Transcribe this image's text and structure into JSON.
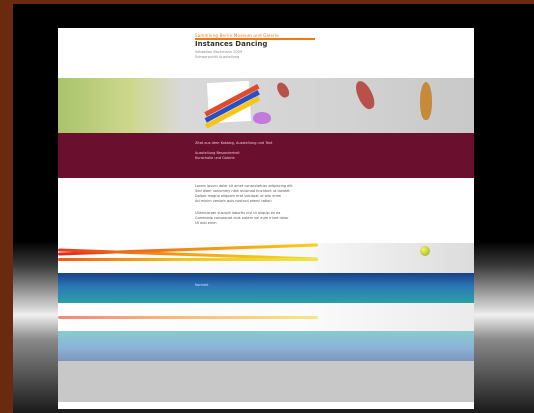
{
  "header": {
    "kicker": "Sammlung Berlin Museum und Galerie",
    "title": "Instances Dancing",
    "sub_lines": [
      "Sebastian Bachmann 2009",
      "Schwerpunkt Ausstellung"
    ]
  },
  "maroon": {
    "lines": [
      "Zitat aus dem Katalog, Ausstellung und Text",
      "Ausstellung Besonderheit",
      "Kunsthalle und Galerie"
    ]
  },
  "body": {
    "lines": [
      "Lorem ipsum dolor sit amet consectetuer adipiscing elit",
      "Sed diam nonummy nibh euismod tincidunt ut laoreet",
      "Dolore magna aliquam erat volutpat ut wisi enim",
      "Ad minim veniam quis nostrud exerci tation",
      "Ullamcorper suscipit lobortis nisl ut aliquip ex ea",
      "Commodo consequat duis autem vel eum iriure dolor",
      "Ut wisi enim"
    ]
  },
  "blue_band": {
    "text": "Kontakt"
  },
  "colors": {
    "accent_orange": "#f07a12",
    "maroon": "#6b0f2e",
    "blue": "#1a3f8a"
  }
}
